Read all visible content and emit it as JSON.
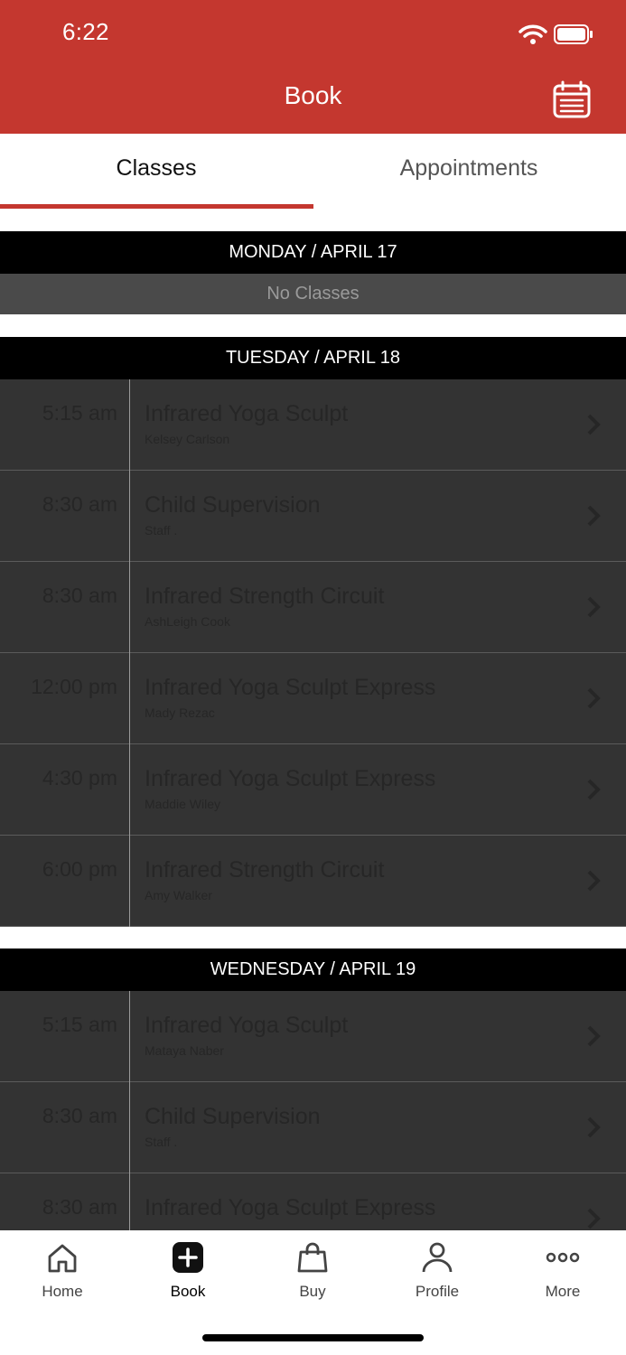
{
  "status": {
    "time": "6:22"
  },
  "header": {
    "title": "Book"
  },
  "tabs": [
    {
      "label": "Classes",
      "active": true
    },
    {
      "label": "Appointments",
      "active": false
    }
  ],
  "days": [
    {
      "header": "MONDAY / APRIL 17",
      "empty_label": "No Classes",
      "classes": []
    },
    {
      "header": "TUESDAY / APRIL 18",
      "classes": [
        {
          "time": "5:15 am",
          "name": "Infrared Yoga Sculpt",
          "instructor": "Kelsey Carlson"
        },
        {
          "time": "8:30 am",
          "name": "Child Supervision",
          "instructor": "Staff ."
        },
        {
          "time": "8:30 am",
          "name": "Infrared Strength Circuit",
          "instructor": "AshLeigh Cook"
        },
        {
          "time": "12:00 pm",
          "name": "Infrared Yoga Sculpt Express",
          "instructor": "Mady Rezac"
        },
        {
          "time": "4:30 pm",
          "name": "Infrared Yoga Sculpt Express",
          "instructor": "Maddie Wiley"
        },
        {
          "time": "6:00 pm",
          "name": "Infrared Strength Circuit",
          "instructor": "Amy Walker"
        }
      ]
    },
    {
      "header": "WEDNESDAY / APRIL 19",
      "classes": [
        {
          "time": "5:15 am",
          "name": "Infrared Yoga Sculpt",
          "instructor": "Mataya Naber"
        },
        {
          "time": "8:30 am",
          "name": "Child Supervision",
          "instructor": "Staff ."
        },
        {
          "time": "8:30 am",
          "name": "Infrared Yoga Sculpt Express",
          "instructor": ""
        }
      ]
    }
  ],
  "nav": [
    {
      "label": "Home",
      "icon": "home-icon"
    },
    {
      "label": "Book",
      "icon": "book-plus-icon",
      "active": true
    },
    {
      "label": "Buy",
      "icon": "shopping-bag-icon"
    },
    {
      "label": "Profile",
      "icon": "profile-icon"
    },
    {
      "label": "More",
      "icon": "more-dots-icon"
    }
  ],
  "colors": {
    "brand": "#c4372f",
    "row_bg": "#333333",
    "day_header_bg": "#000000"
  }
}
